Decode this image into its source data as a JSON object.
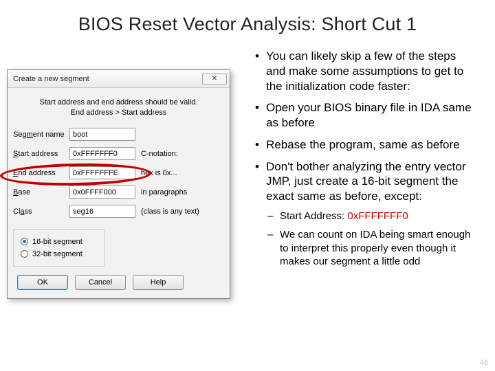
{
  "title": "BIOS Reset Vector Analysis: Short Cut 1",
  "page_num": "46",
  "bullets": {
    "b1": "You can likely skip a few of the steps and make some assumptions to get to the initialization code faster:",
    "b2": "Open your BIOS binary file in IDA same as before",
    "b3": "Rebase the program, same as before",
    "b4": "Don't bother analyzing the entry vector JMP, just create a 16-bit segment the exact same as before, except:",
    "sub1_pre": "Start Address: ",
    "sub1_val": "0xFFFFFFF0",
    "sub2": "We can count on IDA being smart enough to interpret this properly even though it makes our segment a little odd"
  },
  "dialog": {
    "title": "Create a new segment",
    "hint1": "Start address and end address should be valid.",
    "hint2": "End address > Start address",
    "labels": {
      "seg_name": "Seg",
      "seg_name2": "ment name",
      "start": "tart address",
      "end": "nd address",
      "base": "ase",
      "class": "Cl",
      "class2": "ass"
    },
    "values": {
      "seg_name": "boot",
      "start": "0xFFFFFFF0",
      "end": "0xFFFFFFFE",
      "base": "0x0FFFF000",
      "class": "seg16"
    },
    "notes": {
      "c": "C-notation:",
      "hex": "hex is 0x...",
      "para": "in paragraphs",
      "cls": "(class is any text)"
    },
    "radio16": "16-bit segment",
    "radio32": "32-bit segment",
    "ok": "OK",
    "cancel": "Cancel",
    "help": "Help",
    "close": "✕"
  }
}
